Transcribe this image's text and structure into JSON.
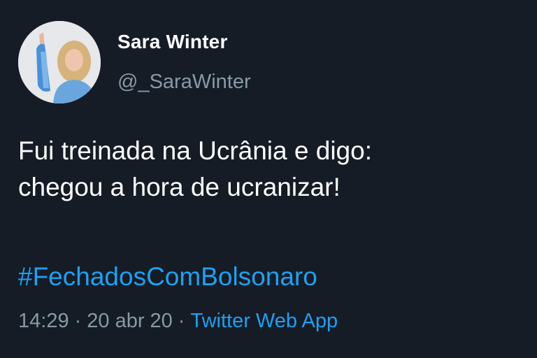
{
  "user": {
    "display_name": "Sara Winter",
    "handle": "@_SaraWinter"
  },
  "tweet": {
    "text": "Fui treinada na Ucrânia e digo:\nchegou a hora de ucranizar!",
    "hashtag": "#FechadosComBolsonaro",
    "time": "14:29",
    "date": "20 abr 20",
    "separator": "·",
    "source": "Twitter Web App"
  },
  "colors": {
    "background": "#151c26",
    "text": "#ffffff",
    "secondary": "#8899a6",
    "link": "#1da1f2"
  }
}
